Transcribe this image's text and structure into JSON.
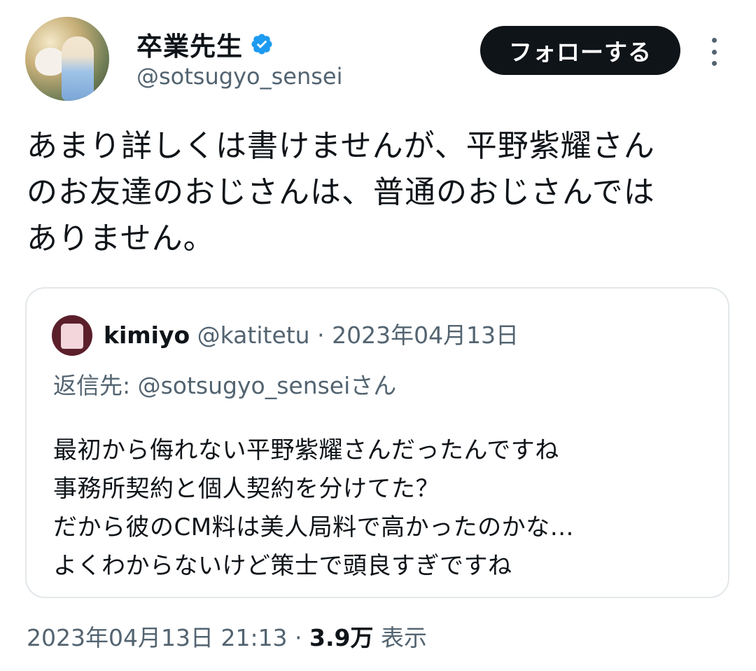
{
  "author": {
    "display_name": "卒業先生",
    "handle": "@sotsugyo_sensei",
    "verified_icon": "verified-badge-icon",
    "verified_color": "#1d9bf0"
  },
  "actions": {
    "follow_label": "フォローする",
    "more_icon": "more-vertical-icon"
  },
  "tweet": {
    "lines": [
      "あまり詳しくは書けませんが、平野紫耀さん",
      "のお友達のおじさんは、普通のおじさんでは",
      "ありません。"
    ]
  },
  "quoted_tweet": {
    "name": "kimiyo",
    "handle": "@katitetu",
    "separator": " · ",
    "date": "2023年04月13日",
    "reply_to": "返信先: @sotsugyo_senseiさん",
    "lines": [
      "最初から侮れない平野紫耀さんだったんですね",
      "事務所契約と個人契約を分けてた？",
      "だから彼のCM料は美人局料で高かったのかな…",
      "よくわからないけど策士で頭良すぎですね"
    ]
  },
  "footer": {
    "timestamp": "2023年04月13日 21:13",
    "separator": " · ",
    "views_count": "3.9万",
    "views_label": " 表示"
  }
}
